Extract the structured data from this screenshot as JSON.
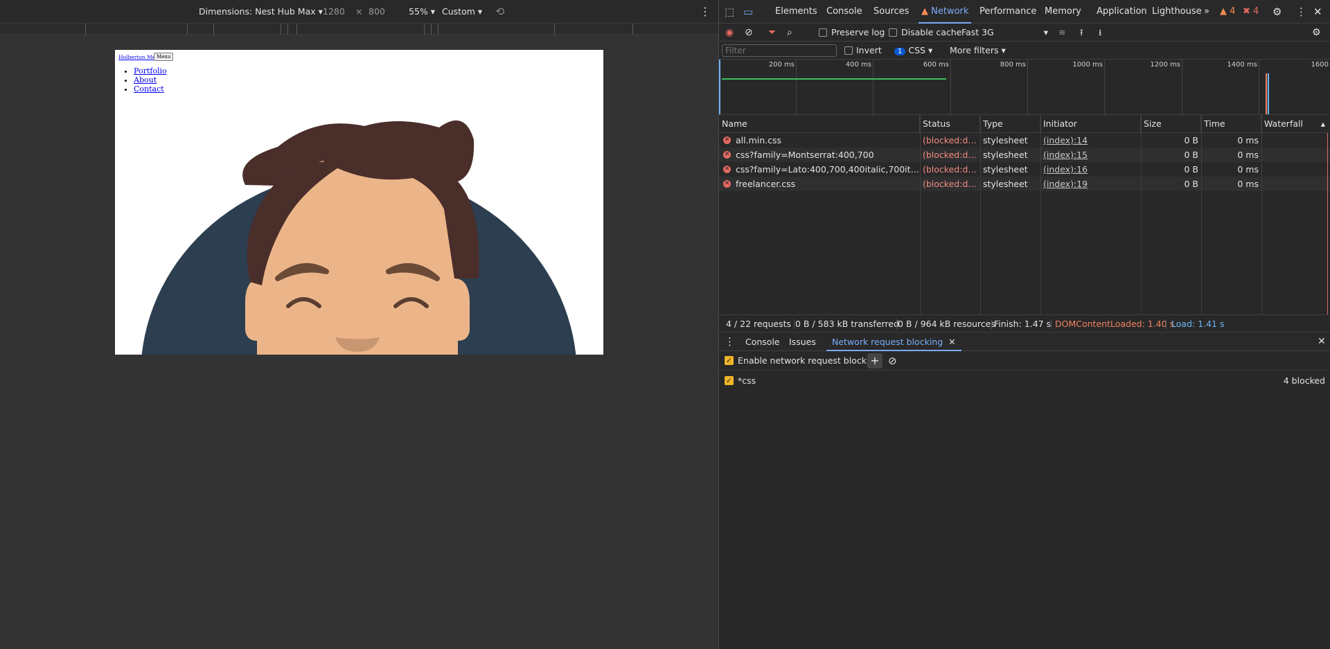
{
  "device_toolbar": {
    "dimensions_label": "Dimensions: Nest Hub Max",
    "width": "1280",
    "times": "×",
    "height": "800",
    "zoom": "55%",
    "throttle": "Custom"
  },
  "viewport": {
    "brand": "Holberton Me",
    "menu_button": "Menu",
    "nav": [
      "Portfolio",
      "About",
      "Contact"
    ]
  },
  "devtools_tabs": [
    "Elements",
    "Console",
    "Sources",
    "Network",
    "Performance",
    "Memory",
    "Application",
    "Lighthouse"
  ],
  "active_tab": "Network",
  "warnings_count": "4",
  "errors_count": "4",
  "network_toolbar": {
    "preserve_log": "Preserve log",
    "disable_cache": "Disable cache",
    "throttling": "Fast 3G"
  },
  "filter_bar": {
    "placeholder": "Filter",
    "invert": "Invert",
    "type_count": "1",
    "type_label": "CSS",
    "more_filters": "More filters"
  },
  "timeline_ticks": [
    "200 ms",
    "400 ms",
    "600 ms",
    "800 ms",
    "1000 ms",
    "1200 ms",
    "1400 ms",
    "1600"
  ],
  "columns": [
    "Name",
    "Status",
    "Type",
    "Initiator",
    "Size",
    "Time",
    "Waterfall"
  ],
  "requests": [
    {
      "name": "all.min.css",
      "status": "(blocked:de…",
      "type": "stylesheet",
      "initiator": "(index):14",
      "size": "0 B",
      "time": "0 ms"
    },
    {
      "name": "css?family=Montserrat:400,700",
      "status": "(blocked:de…",
      "type": "stylesheet",
      "initiator": "(index):15",
      "size": "0 B",
      "time": "0 ms"
    },
    {
      "name": "css?family=Lato:400,700,400italic,700italic",
      "status": "(blocked:de…",
      "type": "stylesheet",
      "initiator": "(index):16",
      "size": "0 B",
      "time": "0 ms"
    },
    {
      "name": "freelancer.css",
      "status": "(blocked:de…",
      "type": "stylesheet",
      "initiator": "(index):19",
      "size": "0 B",
      "time": "0 ms"
    }
  ],
  "summary": {
    "requests": "4 / 22 requests",
    "transferred": "0 B / 583 kB transferred",
    "resources": "0 B / 964 kB resources",
    "finish": "Finish: 1.47 s",
    "dcl": "DOMContentLoaded: 1.40 s",
    "load": "Load: 1.41 s"
  },
  "drawer": {
    "tabs": [
      "Console",
      "Issues",
      "Network request blocking"
    ],
    "enable_label": "Enable network request blocking",
    "pattern": "*css",
    "blocked": "4 blocked"
  },
  "colors": {
    "accent": "#7cacf8",
    "error": "#e46962",
    "dcl": "#f0825f",
    "load": "#6fb6f5",
    "checkbox": "#f0b429"
  }
}
